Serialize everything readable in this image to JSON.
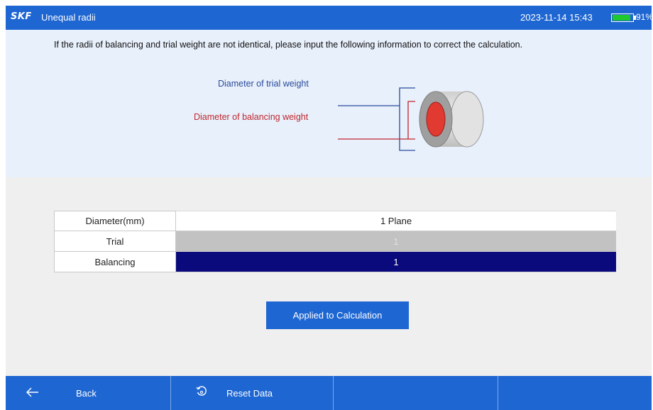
{
  "header": {
    "logo": "SKF",
    "title": "Unequal radii",
    "datetime": "2023-11-14 15:43",
    "battery_percent": "91%",
    "battery_level": 0.91
  },
  "info": {
    "instruction": "If the radii of balancing and trial weight are not identical, please input the following information to correct the calculation.",
    "trial_label": "Diameter of trial weight",
    "balancing_label": "Diameter of balancing weight",
    "colors": {
      "trial": "#2a4a9a",
      "balancing": "#c0272d"
    }
  },
  "table": {
    "header": {
      "label": "Diameter(mm)",
      "column": "1 Plane"
    },
    "rows": [
      {
        "label": "Trial",
        "value": "1"
      },
      {
        "label": "Balancing",
        "value": "1"
      }
    ]
  },
  "apply_button": "Applied to Calculation",
  "bottom": {
    "back_label": "Back",
    "back_icon": "arrow-left-icon",
    "reset_label": "Reset Data",
    "reset_icon": "reset-icon"
  },
  "colors": {
    "accent": "#1e66d2",
    "selected_row": "#0a0a7c",
    "battery": "#1fc82e"
  }
}
